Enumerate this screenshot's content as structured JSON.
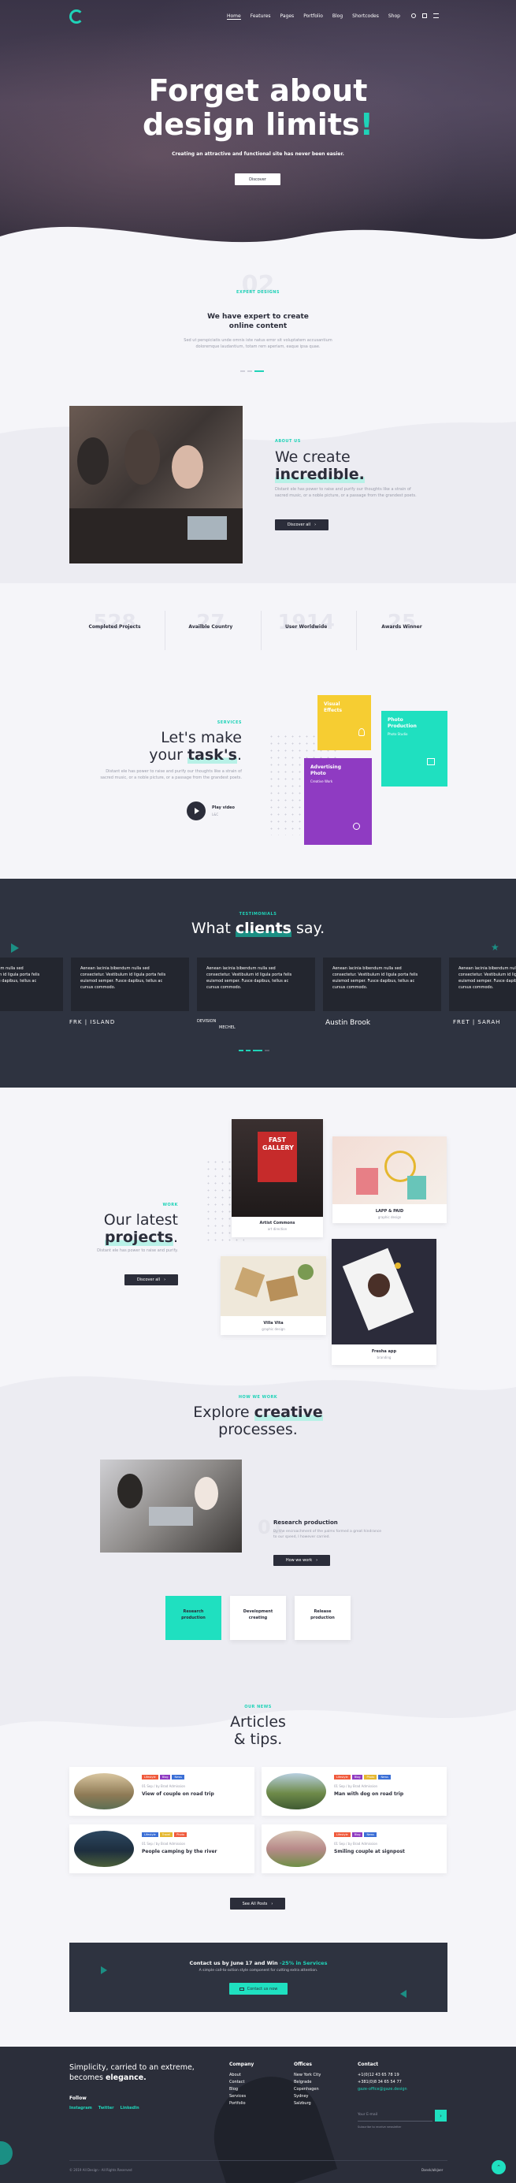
{
  "nav": {
    "items": [
      "Home",
      "Features",
      "Pages",
      "Portfolio",
      "Blog",
      "Shortcodes",
      "Shop"
    ]
  },
  "hero": {
    "title_line1": "Forget about",
    "title_line2": "design limits",
    "title_mark": "!",
    "subtitle": "Creating an attractive and functional site has never been easier.",
    "button": "Discover"
  },
  "intro": {
    "eyebrow": "EXPERT DESIGNS",
    "title_line1": "We have expert to create",
    "title_line2": "online content",
    "text_line1": "Sed ut perspiciatis unde omnis iste natus error sit voluptatem accusantium",
    "text_line2": "doloremque laudantium, totam rem aperiam, eaque ipsa quae."
  },
  "about": {
    "eyebrow": "ABOUT US",
    "title_line1": "We create",
    "title_line2": "incredible.",
    "text_line1": "Distant ele has power to raise and purify our thoughts like a strain of",
    "text_line2": "sacred music, or a noble picture, or a passage from the grandest poets.",
    "button": "Discover all"
  },
  "stats": [
    {
      "number": "528",
      "label": "Completed Projects"
    },
    {
      "number": "27",
      "label": "Availble Country"
    },
    {
      "number": "1914",
      "label": "User Worldwide"
    },
    {
      "number": "25",
      "label": "Awards Winner"
    }
  ],
  "services": {
    "eyebrow": "SERVICES",
    "title_line1": "Let's make",
    "title_line2a": "your ",
    "title_line2b": "task's",
    "title_line2c": ".",
    "text_line1": "Distant ele has power to raise and purify our thoughts like a strain of",
    "text_line2": "sacred music, or a noble picture, or a passage from the grandest poets.",
    "play_label": "Play video",
    "play_sub": "L&C",
    "cards": [
      {
        "title": "Visual Effects",
        "sub": ""
      },
      {
        "title": "Photo Production",
        "sub": "Photo Studio"
      },
      {
        "title": "Advertising Photo",
        "sub": "Creative Work"
      }
    ]
  },
  "testimonials": {
    "eyebrow": "TESTIMONIALS",
    "title_pre": "What ",
    "title_hl": "clients",
    "title_post": " say.",
    "quote_line1": "Aenean lacinia bibendum nulla sed",
    "quote_line2": "consectetur. Vestibulum id ligula porta felis",
    "quote_line3": "euismod semper. Fusce dapibus, tellus ac",
    "quote_line4": "cursus commodo.",
    "logos": [
      "FRK | ISLAND",
      "DEVISION",
      "MECHEL",
      "Austin Brook",
      "FRET | SARAH"
    ]
  },
  "projects": {
    "eyebrow": "WORK",
    "title_line1": "Our latest",
    "title_line2": "projects",
    "title_mark": ".",
    "text": "Distant ele has power to raise and purify.",
    "button": "Discover all",
    "items": [
      {
        "title": "Artist Commons",
        "sub": "art direction",
        "poster": "FAST GALLERY"
      },
      {
        "title": "LAPP & PAID",
        "sub": "graphic design"
      },
      {
        "title": "Villa Vita",
        "sub": "graphic design"
      },
      {
        "title": "Fresha app",
        "sub": "branding"
      }
    ]
  },
  "process": {
    "eyebrow": "HOW WE WORK",
    "title_pre": "Explore ",
    "title_hl": "creative",
    "title_line2": "processes.",
    "step_number": "01",
    "step_title": "Research production",
    "step_text_line1": "By the encroachment of the palms formed a great hindrance",
    "step_text_line2": "to our speed, I however carried.",
    "button": "How we work",
    "tabs": [
      {
        "label_line1": "Research",
        "label_line2": "production"
      },
      {
        "label_line1": "Development",
        "label_line2": "creating"
      },
      {
        "label_line1": "Release",
        "label_line2": "production"
      }
    ]
  },
  "articles": {
    "eyebrow": "OUR NEWS",
    "title_line1": "Articles",
    "title_line2": "& tips.",
    "button": "See All Posts",
    "items": [
      {
        "meta": "01 Sep / by Brad Admission",
        "title": "View of couple on road trip",
        "tags": [
          "Lifestyle",
          "Blog",
          "News"
        ]
      },
      {
        "meta": "01 Sep / by Brad Admission",
        "title": "Man with dog on road trip",
        "tags": [
          "Lifestyle",
          "Blog",
          "Photo",
          "News"
        ]
      },
      {
        "meta": "01 Sep / by Brad Admission",
        "title": "People camping by the river",
        "tags": [
          "Lifestyle",
          "Travel",
          "Photo"
        ]
      },
      {
        "meta": "01 Sep / by Brad Admission",
        "title": "Smiling couple at signpost",
        "tags": [
          "Lifestyle",
          "Blog",
          "News"
        ]
      }
    ]
  },
  "cta": {
    "title_pre": "Contact us by June 17 and Win ",
    "title_hl": "-25% in Services",
    "text": "A simple call-to-action style component for cutting extra attention.",
    "button": "Contact us now"
  },
  "footer": {
    "tagline_line1": "Simplicity, carried to an extreme,",
    "tagline_line2": "becomes ",
    "tagline_hl": "elegance.",
    "follow": "Follow",
    "social": [
      "Instagram",
      "Twitter",
      "LinkedIn"
    ],
    "company_title": "Company",
    "company_links": [
      "About",
      "Contact",
      "Blog",
      "Services",
      "Portfolio"
    ],
    "offices_title": "Offices",
    "offices": [
      "New York City",
      "Belgrade",
      "Copenhagen",
      "Sydney",
      "Salzburg"
    ],
    "contact_title": "Contact",
    "phone1": "+1(0)12 43 65 78 19",
    "phone2": "+381(0)8 34 65 54 77",
    "email": "gaze-office@gaze.design",
    "email_placeholder": "Your E-mail",
    "newsletter_hint": "Subscribe to receive newsletter",
    "copyright": "© 2019 All Design - All Rights Reserved",
    "lang": "Dansk/alkjaer"
  }
}
